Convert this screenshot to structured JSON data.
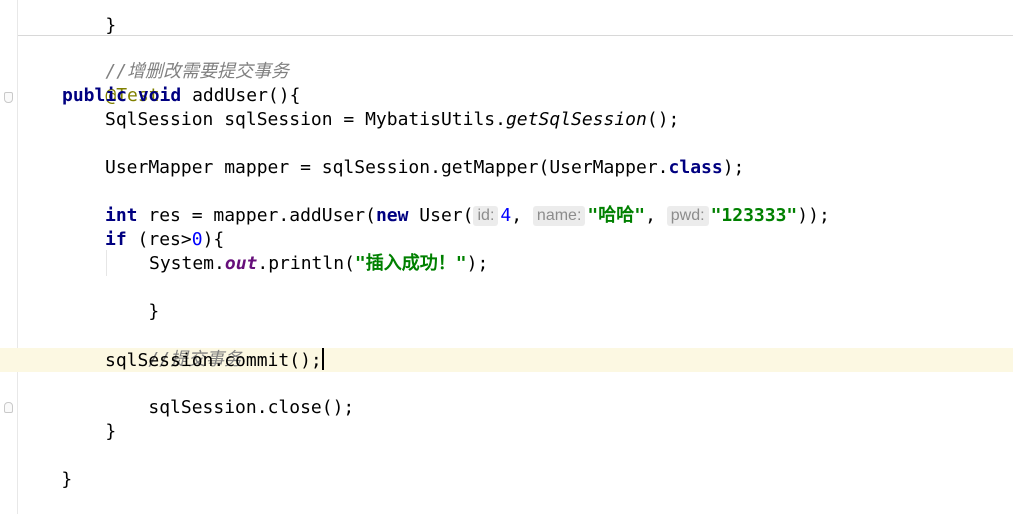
{
  "editor": {
    "lines": {
      "prev_close": "}",
      "comment_crud": "//增删改需要提交事务",
      "annotation": "@Test",
      "kw_public": "public",
      "kw_void": "void",
      "method_sig": "addUser(){",
      "l1_type": "SqlSession sqlSession = MybatisUtils.",
      "l1_call": "getSqlSession",
      "l1_end": "();",
      "l2_start": "UserMapper mapper = sqlSession.getMapper(UserMapper.",
      "l2_kw": "class",
      "l2_end": ");",
      "l3_kw_int": "int",
      "l3_mid": " res = mapper.addUser(",
      "l3_kw_new": "new",
      "l3_user": " User(",
      "hint_id": "id:",
      "val_id": "4",
      "hint_name": "name:",
      "val_name": "\"哈哈\"",
      "hint_pwd": "pwd:",
      "val_pwd": "\"123333\"",
      "l3_end": "));",
      "l4_kw_if": "if",
      "l4_cond": " (res>",
      "l4_num": "0",
      "l4_end": "){",
      "l5_start": "System.",
      "l5_field": "out",
      "l5_call": ".println(",
      "l5_str": "\"插入成功！\"",
      "l5_end": ");",
      "close_if": "}",
      "comment_commit": "//提交事务",
      "commit": "sqlSession.commit();",
      "close_session": "sqlSession.close();",
      "close_method": "}",
      "close_class": "}"
    }
  }
}
